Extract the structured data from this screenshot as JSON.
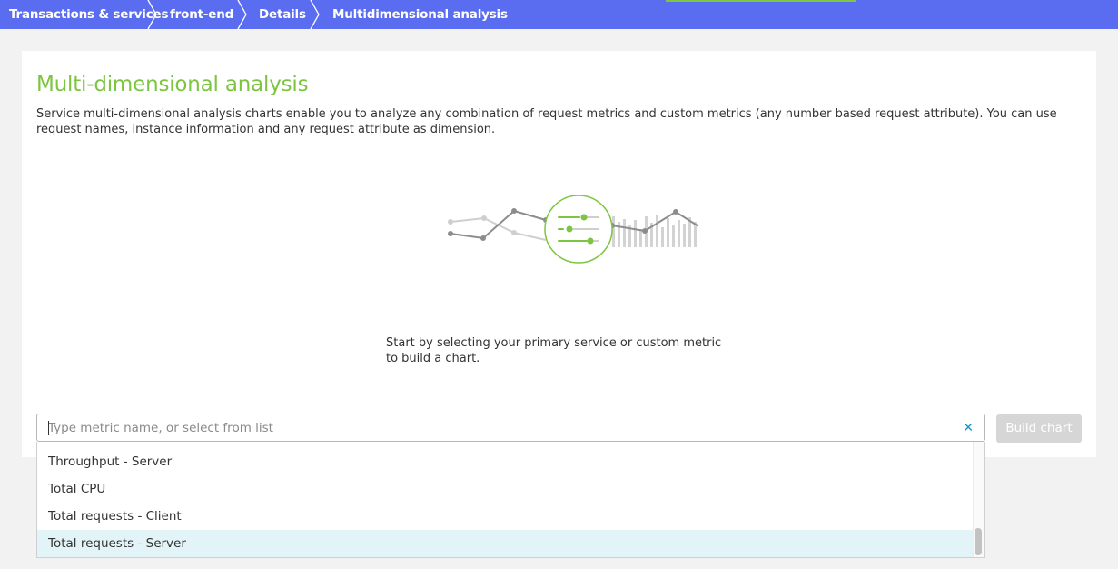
{
  "breadcrumb": {
    "items": [
      {
        "label": "Transactions & services"
      },
      {
        "label": "front-end"
      },
      {
        "label": "Details"
      },
      {
        "label": "Multidimensional analysis"
      }
    ]
  },
  "colors": {
    "breadcrumb_bg": "#5a6cf0",
    "accent_green": "#7dc540",
    "link_blue": "#1496c8",
    "highlight_row": "#e3f4f8"
  },
  "page": {
    "title": "Multi-dimensional analysis",
    "description": "Service multi-dimensional analysis charts enable you to analyze any combination of request metrics and custom metrics (any number based request attribute). You can use request names, instance information and any request attribute as dimension.",
    "start_text": "Start by selecting your primary service or custom metric to build a chart.",
    "illustration_icon": "sliders-filter-icon"
  },
  "metric_search": {
    "value": "",
    "placeholder": "Type metric name, or select from list",
    "clear_icon": "close-icon"
  },
  "build_button": {
    "label": "Build chart",
    "state": "disabled"
  },
  "dropdown": {
    "options": [
      {
        "label": "Throughput - Server",
        "highlighted": false
      },
      {
        "label": "Total CPU",
        "highlighted": false
      },
      {
        "label": "Total requests - Client",
        "highlighted": false
      },
      {
        "label": "Total requests - Server",
        "highlighted": true
      }
    ]
  }
}
